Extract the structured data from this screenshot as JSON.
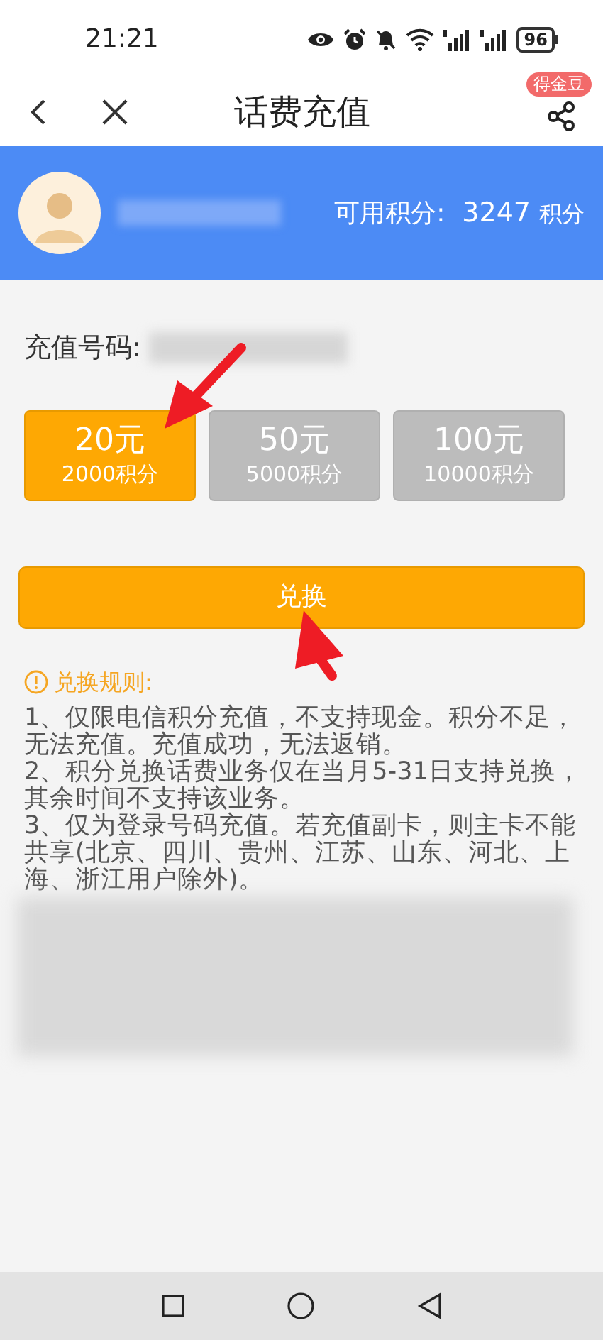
{
  "status_bar": {
    "time": "21:21",
    "battery": "96"
  },
  "header": {
    "title": "话费充值",
    "badge": "得金豆"
  },
  "account": {
    "points_label": "可用积分:",
    "points_value": "3247",
    "points_unit": "积分"
  },
  "recharge": {
    "label": "充值号码:"
  },
  "options": [
    {
      "amount": "20元",
      "points": "2000积分",
      "selected": true
    },
    {
      "amount": "50元",
      "points": "5000积分",
      "selected": false
    },
    {
      "amount": "100元",
      "points": "10000积分",
      "selected": false
    }
  ],
  "exchange_button": "兑换",
  "rules": {
    "title": "兑换规则:",
    "items": [
      "1、仅限电信积分充值，不支持现金。积分不足，无法充值。充值成功，无法返销。",
      "2、积分兑换话费业务仅在当月5-31日支持兑换，其余时间不支持该业务。",
      "3、仅为登录号码充值。若充值副卡，则主卡不能共享(北京、四川、贵州、江苏、山东、河北、上海、浙江用户除外)。"
    ]
  }
}
